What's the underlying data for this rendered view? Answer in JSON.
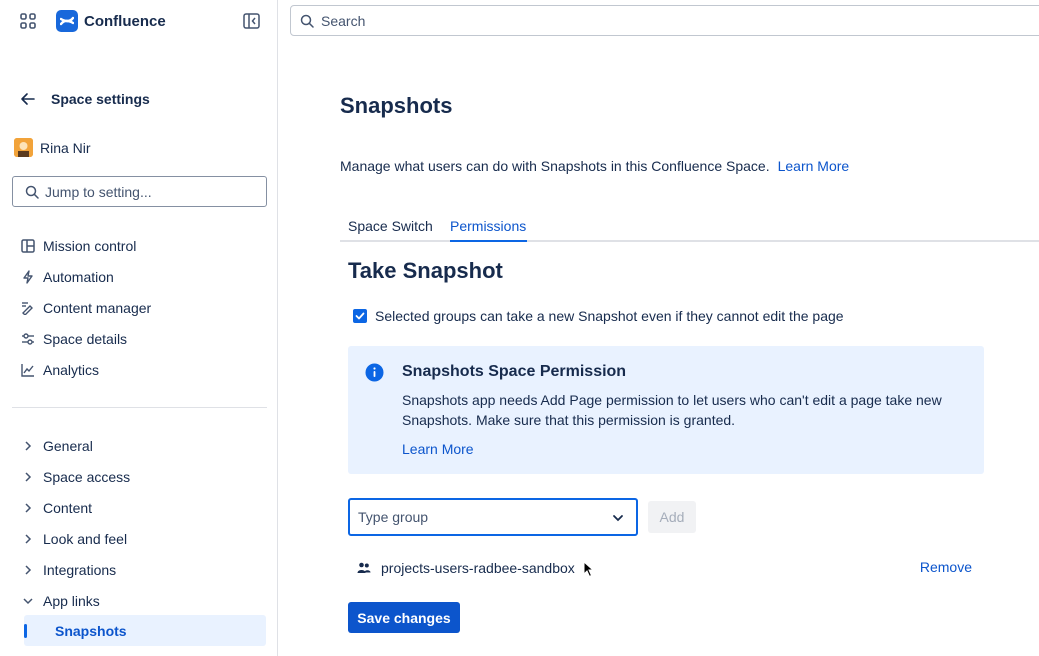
{
  "app": {
    "name": "Confluence"
  },
  "sidebar": {
    "back_title": "Space settings",
    "user_name": "Rina Nir",
    "jump_placeholder": "Jump to setting...",
    "primary_items": [
      {
        "label": "Mission control",
        "icon": "mission-control-icon"
      },
      {
        "label": "Automation",
        "icon": "lightning-icon"
      },
      {
        "label": "Content manager",
        "icon": "content-manager-icon"
      },
      {
        "label": "Space details",
        "icon": "sliders-icon"
      },
      {
        "label": "Analytics",
        "icon": "chart-icon"
      }
    ],
    "secondary_items": [
      {
        "label": "General",
        "icon": "chevron-right-icon"
      },
      {
        "label": "Space access",
        "icon": "chevron-right-icon"
      },
      {
        "label": "Content",
        "icon": "chevron-right-icon"
      },
      {
        "label": "Look and feel",
        "icon": "chevron-right-icon"
      },
      {
        "label": "Integrations",
        "icon": "chevron-right-icon"
      },
      {
        "label": "App links",
        "icon": "chevron-down-icon"
      }
    ],
    "active_child": "Snapshots"
  },
  "search": {
    "placeholder": "Search"
  },
  "main": {
    "title": "Snapshots",
    "description": "Manage what users can do with Snapshots in this Confluence Space.",
    "description_link": "Learn More",
    "tabs": [
      {
        "label": "Space Switch",
        "active": false
      },
      {
        "label": "Permissions",
        "active": true
      }
    ],
    "section_title": "Take Snapshot",
    "checkbox_label": "Selected groups can take a new Snapshot even if they cannot edit the page",
    "checkbox_checked": true,
    "info": {
      "title": "Snapshots Space Permission",
      "body": "Snapshots app needs Add Page permission to let users who can't edit a page take new Snapshots. Make sure that this permission is granted.",
      "link": "Learn More"
    },
    "group_placeholder": "Type group",
    "add_label": "Add",
    "groups": [
      {
        "name": "projects-users-radbee-sandbox",
        "remove_label": "Remove"
      }
    ],
    "save_label": "Save changes"
  },
  "colors": {
    "accent": "#0c55cc",
    "info_bg": "#e9f2ff",
    "text": "#172b4d"
  }
}
